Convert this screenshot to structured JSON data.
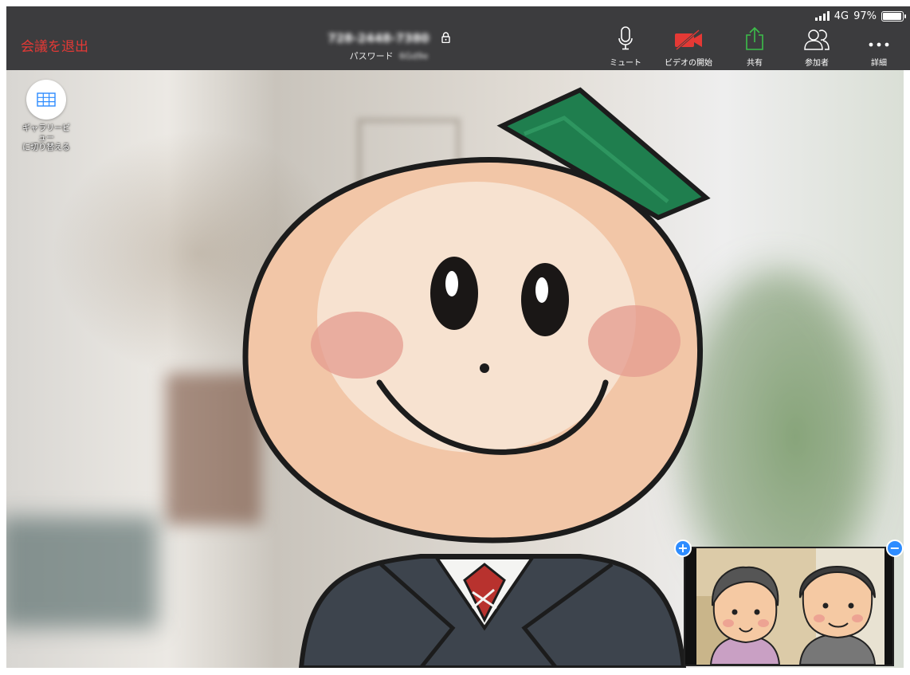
{
  "status": {
    "signal_label": "4G",
    "battery_percent": "97%",
    "battery_level": 0.97
  },
  "toolbar": {
    "leave_label": "会議を退出",
    "meeting_id": "728-2448-7380",
    "password_label": "パスワード",
    "password_value": "6Gd9e",
    "tools": {
      "mute": "ミュート",
      "start_video": "ビデオの開始",
      "share": "共有",
      "participants": "参加者",
      "more": "詳細"
    }
  },
  "gallery": {
    "label_line1": "ギャラリービ",
    "label_line2": "ュー",
    "label_line3": "に切り替える"
  },
  "thumbnail": {
    "zoom_in": "+",
    "zoom_out": "−"
  },
  "colors": {
    "toolbar_bg": "#3c3c3e",
    "leave": "#e53935",
    "video_off": "#e53935",
    "share": "#3dbd4a",
    "accent": "#2d8cff"
  }
}
